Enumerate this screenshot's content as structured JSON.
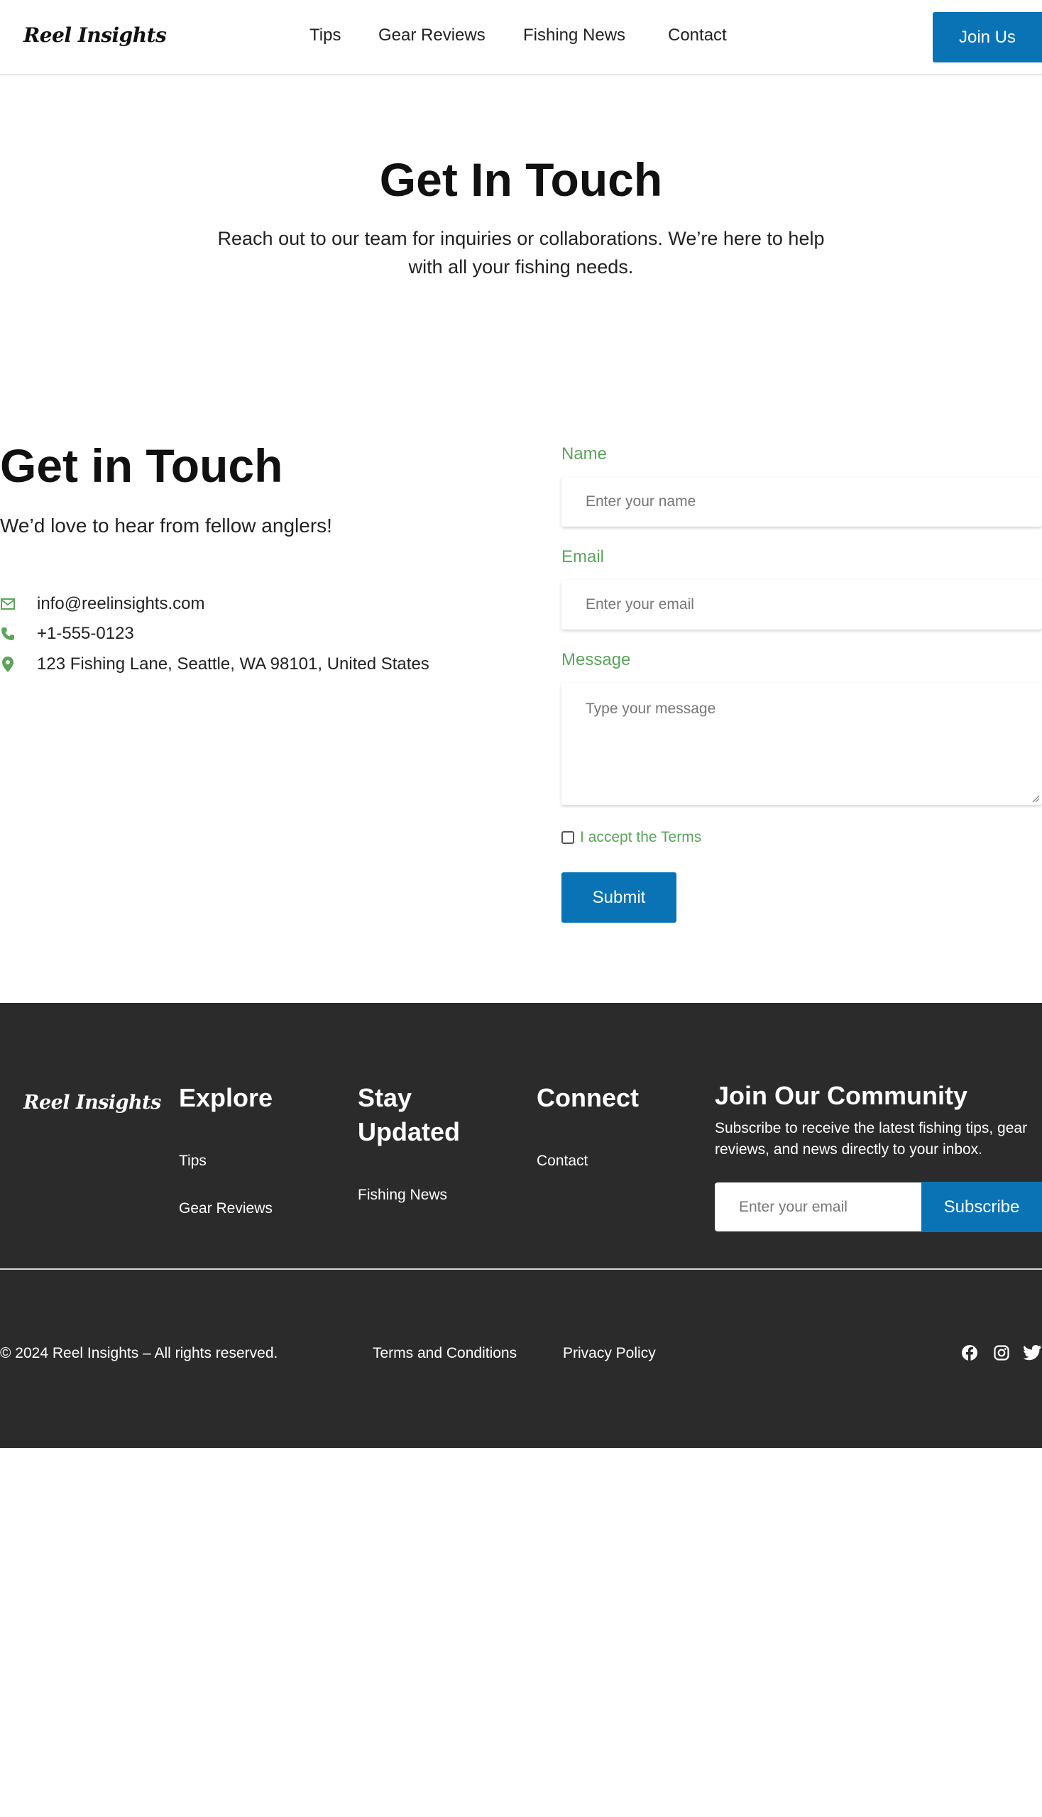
{
  "header": {
    "logo": "Reel Insights",
    "nav": [
      "Tips",
      "Gear Reviews",
      "Fishing News",
      "Contact"
    ],
    "join_label": "Join Us"
  },
  "hero": {
    "title": "Get In Touch",
    "subtitle": "Reach out to our team for inquiries or collaborations. We’re here to help with all your fishing needs."
  },
  "contact": {
    "title": "Get in Touch",
    "subtitle": "We’d love to hear from fellow anglers!",
    "email": "info@reelinsights.com",
    "phone": "+1-555-0123",
    "address": "123 Fishing Lane, Seattle, WA 98101, United States",
    "icons": [
      "envelope-icon",
      "phone-icon",
      "map-marker-icon"
    ],
    "icon_color": "#5aa55a"
  },
  "form": {
    "name_label": "Name",
    "name_placeholder": "Enter your name",
    "email_label": "Email",
    "email_placeholder": "Enter your email",
    "message_label": "Message",
    "message_placeholder": "Type your message",
    "terms_label": "I accept the Terms",
    "terms_checked": false,
    "submit_label": "Submit",
    "label_color": "#5aa55a",
    "accent_color": "#0a73b5"
  },
  "footer": {
    "logo": "Reel Insights",
    "explore": {
      "title": "Explore",
      "links": [
        "Tips",
        "Gear Reviews"
      ]
    },
    "stay_updated": {
      "title": "Stay Updated",
      "links": [
        "Fishing News"
      ]
    },
    "connect": {
      "title": "Connect",
      "links": [
        "Contact"
      ]
    },
    "community": {
      "title": "Join Our Community",
      "subtitle": "Subscribe to receive the latest fishing tips, gear reviews, and news directly to your inbox.",
      "email_placeholder": "Enter your email",
      "subscribe_label": "Subscribe"
    },
    "copyright": "© 2024 Reel Insights – All rights reserved.",
    "legal_links": [
      "Terms and Conditions",
      "Privacy Policy"
    ],
    "social_icons": [
      "facebook-icon",
      "instagram-icon",
      "twitter-icon"
    ],
    "background": "#2b2b2b"
  }
}
